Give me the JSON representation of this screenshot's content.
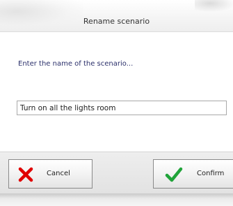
{
  "dialog": {
    "title": "Rename scenario",
    "prompt": "Enter the name of the scenario...",
    "name_value": "Turn on all the lights room"
  },
  "buttons": {
    "cancel": {
      "label": "Cancel",
      "icon": "red-x-icon",
      "icon_color": "#e00000"
    },
    "confirm": {
      "label": "Confirm",
      "icon": "green-check-icon",
      "icon_color": "#1fa339"
    }
  }
}
